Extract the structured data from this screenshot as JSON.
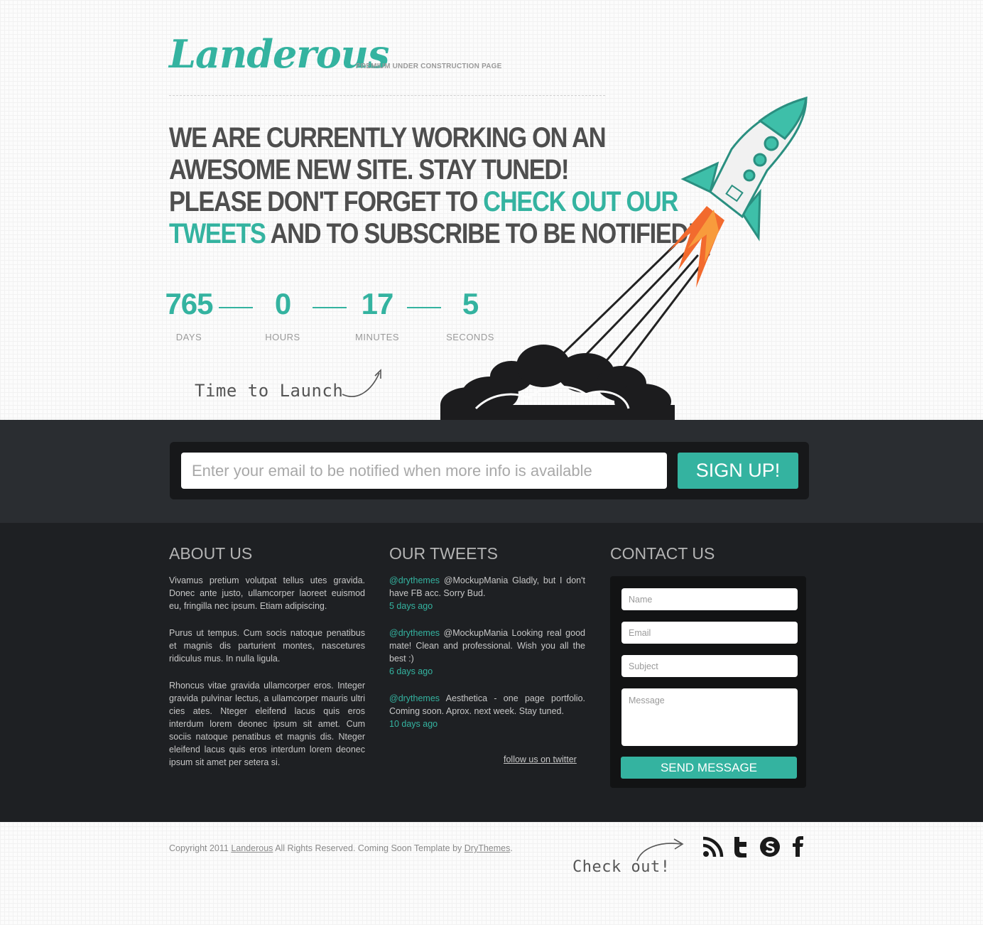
{
  "header": {
    "logo": "Landerous",
    "tagline": "PREMIUM UNDER CONSTRUCTION PAGE"
  },
  "headline": {
    "part1": "WE ARE CURRENTLY WORKING ON AN",
    "part2": "AWESOME NEW SITE. STAY TUNED!",
    "part3": "PLEASE DON'T FORGET TO ",
    "highlight1a": "CHECK OUT OUR",
    "highlight1b": "TWEETS",
    "part4": " AND TO SUBSCRIBE TO BE NOTIFIED!"
  },
  "countdown": {
    "days": "765",
    "days_label": "DAYS",
    "hours": "0",
    "hours_label": "HOURS",
    "minutes": "17",
    "minutes_label": "MINUTES",
    "seconds": "5",
    "seconds_label": "SECONDS"
  },
  "launch_note": "Time to Launch",
  "signup": {
    "placeholder": "Enter your email to be notified when more info is available",
    "button": "SIGN UP!"
  },
  "about": {
    "title": "ABOUT US",
    "paragraphs": [
      "Vivamus pretium volutpat tellus utes gravida. Donec ante justo, ullamcorper laoreet euismod eu, fringilla nec ipsum. Etiam adipiscing.",
      "Purus ut tempus. Cum socis natoque penatibus et magnis dis parturient montes, nascetures ridiculus mus. In nulla ligula.",
      "Rhoncus vitae gravida ullamcorper eros. Integer gravida pulvinar lectus, a ullamcorper mauris ultri cies ates. Nteger eleifend lacus quis eros interdum lorem deonec ipsum sit amet. Cum sociis natoque penatibus et magnis dis. Nteger eleifend lacus quis eros interdum lorem deonec ipsum sit amet per setera si."
    ]
  },
  "tweets": {
    "title": "OUR TWEETS",
    "items": [
      {
        "user": "@drythemes",
        "text": " @MockupMania Gladly, but I don't have FB acc. Sorry Bud.",
        "when": "5 days ago"
      },
      {
        "user": "@drythemes",
        "text": " @MockupMania Looking real good mate! Clean and professional. Wish you all the best :)",
        "when": "6 days ago"
      },
      {
        "user": "@drythemes",
        "text": " Aesthetica - one page portfolio. Coming soon. Aprox. next week. Stay tuned.",
        "when": "10 days ago"
      }
    ],
    "follow": "follow us on twitter"
  },
  "contact": {
    "title": "CONTACT US",
    "name_placeholder": "Name",
    "email_placeholder": "Email",
    "subject_placeholder": "Subject",
    "message_placeholder": "Message",
    "send": "SEND MESSAGE"
  },
  "footer": {
    "copyright_prefix": "Copyright 2011 ",
    "brand_link": "Landerous",
    "copyright_mid": " All Rights Reserved. Coming Soon Template by ",
    "author_link": "DryThemes",
    "copyright_suffix": ".",
    "check_out": "Check out!",
    "social_icons": [
      "rss-icon",
      "twitter-icon",
      "skype-icon",
      "facebook-icon"
    ]
  },
  "colors": {
    "accent": "#34b3a0",
    "dark": "#1e2023",
    "heading": "#4e4e4e"
  }
}
